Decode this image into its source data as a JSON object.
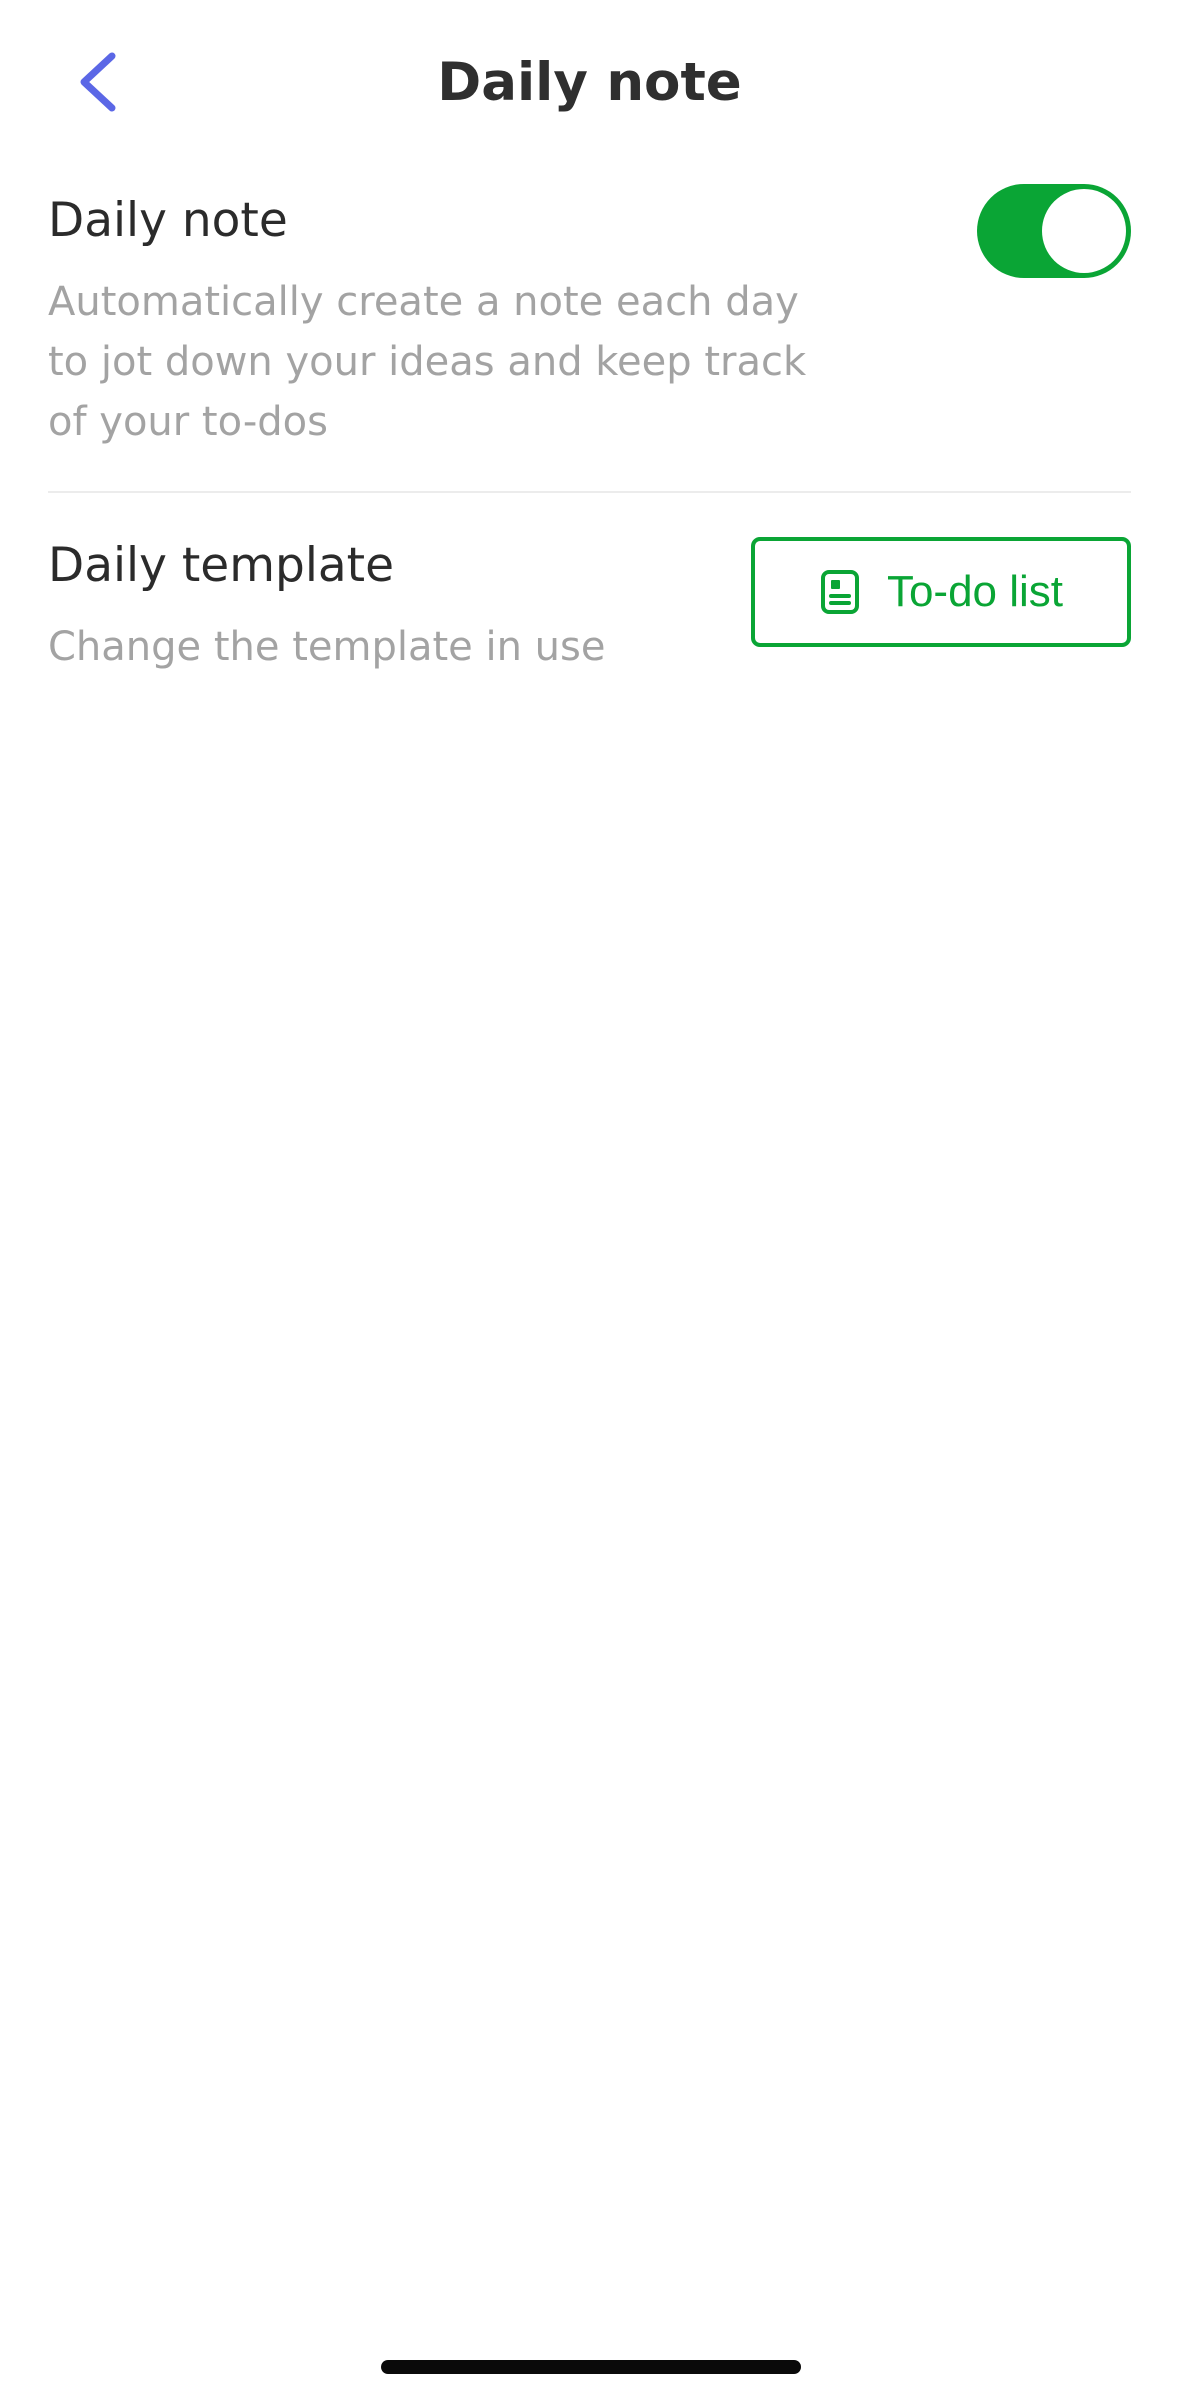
{
  "header": {
    "title": "Daily note",
    "back_icon": "chevron-left-icon",
    "back_color": "#5b67e6"
  },
  "daily_note_setting": {
    "title": "Daily note",
    "description": "Automatically create a note each day to jot down your ideas and keep track of your to-dos",
    "toggle_on": true,
    "toggle_color": "#0aa535"
  },
  "daily_template_setting": {
    "title": "Daily template",
    "description": "Change the template in use",
    "button_label": "To-do list",
    "button_icon": "document-icon",
    "button_color": "#0aa535"
  }
}
